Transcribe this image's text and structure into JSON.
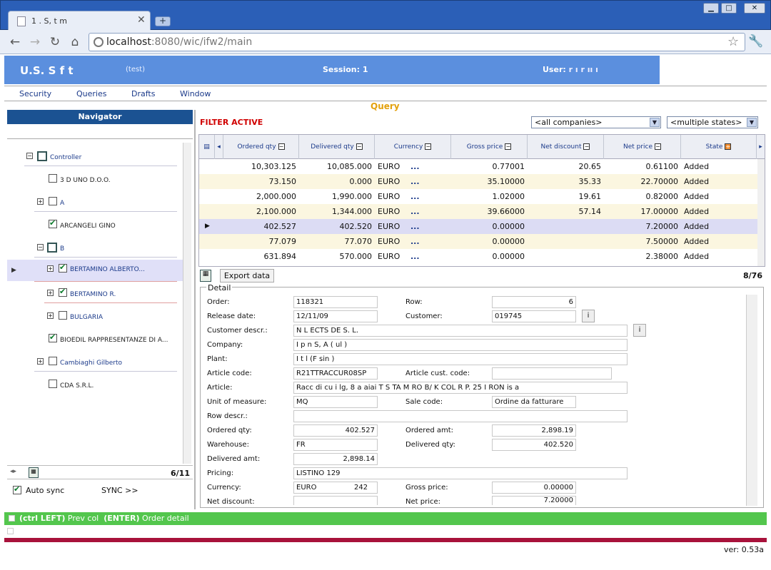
{
  "browser": {
    "tab_title": "1 . S,   t  m",
    "url_host": "localhost",
    "url_rest": ":8080/wic/ifw2/main",
    "min": "▁",
    "max": "□",
    "close": "✕",
    "newtab": "+"
  },
  "header": {
    "app_name": "U.S. S  f  t",
    "env": "(test)",
    "session_label": "Session: 1",
    "user_label": "User: ",
    "user_name": "r   ı   r  ıı  ı"
  },
  "menu": [
    "Security",
    "Queries",
    "Drafts",
    "Window"
  ],
  "navigator": {
    "title": "Navigator",
    "count": "6/11",
    "auto_sync": "Auto sync",
    "sync_btn": "SYNC >>",
    "nodes": [
      {
        "label": "Controller"
      },
      {
        "label": "3 D UNO D.O.O."
      },
      {
        "label": "A"
      },
      {
        "label": "ARCANGELI GINO"
      },
      {
        "label": "B"
      },
      {
        "label": "BERTAMINO ALBERTO..."
      },
      {
        "label": "BERTAMINO R."
      },
      {
        "label": "BULGARIA"
      },
      {
        "label": "BIOEDIL RAPPRESENTANZE DI A..."
      },
      {
        "label": "Cambiaghi Gilberto"
      },
      {
        "label": "CDA S.R.L."
      }
    ]
  },
  "query": {
    "title": "Query",
    "filter_status": "FILTER ACTIVE",
    "company_select": "<all companies>",
    "state_select": "<multiple states>",
    "columns": [
      "Ordered qty",
      "Delivered qty",
      "Currency",
      "Gross price",
      "Net discount",
      "Net price",
      "State"
    ],
    "rows": [
      [
        "10,303.125",
        "10,085.000",
        "EURO",
        "...",
        "0.77001",
        "20.65",
        "0.61100",
        "Added"
      ],
      [
        "73.150",
        "0.000",
        "EURO",
        "...",
        "35.10000",
        "35.33",
        "22.70000",
        "Added"
      ],
      [
        "2,000.000",
        "1,990.000",
        "EURO",
        "...",
        "1.02000",
        "19.61",
        "0.82000",
        "Added"
      ],
      [
        "2,100.000",
        "1,344.000",
        "EURO",
        "...",
        "39.66000",
        "57.14",
        "17.00000",
        "Added"
      ],
      [
        "402.527",
        "402.520",
        "EURO",
        "...",
        "0.00000",
        "",
        "7.20000",
        "Added"
      ],
      [
        "77.079",
        "77.070",
        "EURO",
        "...",
        "0.00000",
        "",
        "7.50000",
        "Added"
      ],
      [
        "631.894",
        "570.000",
        "EURO",
        "...",
        "0.00000",
        "",
        "2.38000",
        "Added"
      ]
    ],
    "export_label": "Export data",
    "count": "8/76"
  },
  "detail": {
    "legend": "Detail",
    "labels": {
      "order": "Order:",
      "row": "Row:",
      "release": "Release date:",
      "customer": "Customer:",
      "cust_descr": "Customer descr.:",
      "company": "Company:",
      "plant": "Plant:",
      "article_code": "Article code:",
      "article_cust": "Article cust. code:",
      "article": "Article:",
      "uom": "Unit of measure:",
      "sale_code": "Sale code:",
      "row_descr": "Row descr.:",
      "ordered_qty": "Ordered qty:",
      "ordered_amt": "Ordered amt:",
      "warehouse": "Warehouse:",
      "delivered_qty": "Delivered qty:",
      "delivered_amt": "Delivered amt:",
      "pricing": "Pricing:",
      "currency": "Currency:",
      "gross_price": "Gross price:",
      "net_discount": "Net discount:",
      "net_price": "Net price:"
    },
    "values": {
      "order": "118321",
      "row": "6",
      "release": "12/11/09",
      "customer": "019745",
      "cust_descr": "N  L ECTS  DE   S.  L.",
      "company": "I  p  n S,  A (   ul  )",
      "plant": "I   t  l     (F  sin   )",
      "article_code": "R21TTRACCUR08SP",
      "article_cust": "",
      "article": "Racc    di cu  i lg,   8   a  aiai  T   S TA M   RO     B/   K COL   R P.   25     I   RON    is    a",
      "uom": "MQ",
      "sale_code": "Ordine da fatturare",
      "row_descr": "",
      "ordered_qty": "402.527",
      "ordered_amt": "2,898.19",
      "warehouse": "FR",
      "delivered_qty": "402.520",
      "delivered_amt": "2,898.14",
      "pricing": "LISTINO 129",
      "currency": "EURO",
      "currency_code": "242",
      "gross_price": "0.00000",
      "net_discount": "",
      "net_price": "7.20000"
    },
    "info_btn": "i"
  },
  "status": {
    "key1": "(ctrl LEFT)",
    "text1": "Prev col",
    "key2": "(ENTER)",
    "text2": "Order detail"
  },
  "version": "ver: 0.53a",
  "colors": {
    "header_blue": "#5b8fde",
    "status_green": "#53c64d",
    "filter_red": "#d00000",
    "query_orange": "#e3a10e",
    "crimson": "#a8123b"
  }
}
